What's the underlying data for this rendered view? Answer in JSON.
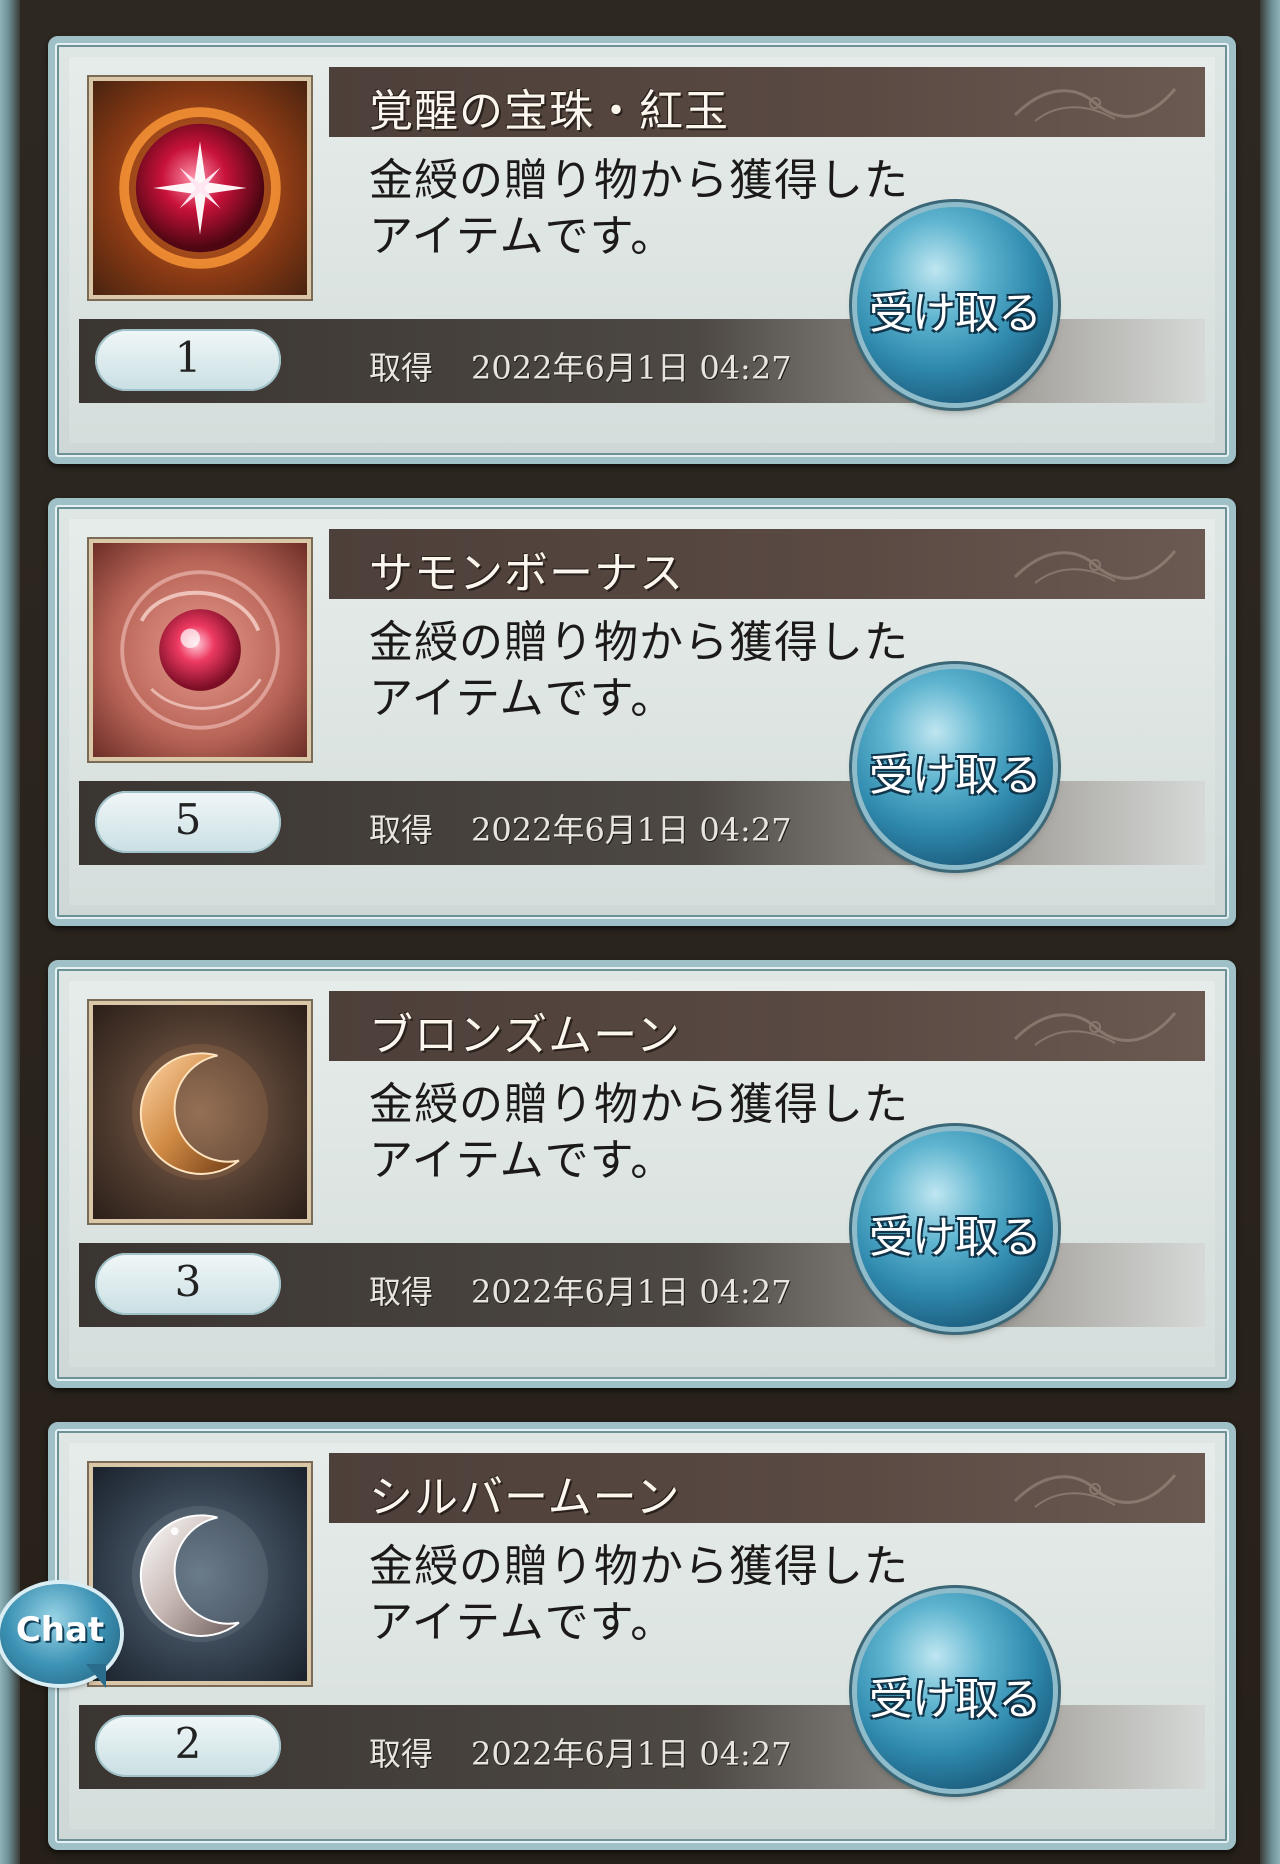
{
  "present_list": {
    "items": [
      {
        "name": "覚醒の宝珠・紅玉",
        "description": "金綬の贈り物から獲得したアイテムです。",
        "quantity": "1",
        "acquired_label": "取得",
        "acquired_date": "2022年6月1日 04:27",
        "receive_label": "受け取る",
        "icon": "crimson-orb-icon"
      },
      {
        "name": "サモンボーナス",
        "description": "金綬の贈り物から獲得したアイテムです。",
        "quantity": "5",
        "acquired_label": "取得",
        "acquired_date": "2022年6月1日 04:27",
        "receive_label": "受け取る",
        "icon": "summon-orb-icon"
      },
      {
        "name": "ブロンズムーン",
        "description": "金綬の贈り物から獲得したアイテムです。",
        "quantity": "3",
        "acquired_label": "取得",
        "acquired_date": "2022年6月1日 04:27",
        "receive_label": "受け取る",
        "icon": "bronze-moon-icon"
      },
      {
        "name": "シルバームーン",
        "description": "金綬の贈り物から獲得したアイテムです。",
        "quantity": "2",
        "acquired_label": "取得",
        "acquired_date": "2022年6月1日 04:27",
        "receive_label": "受け取る",
        "icon": "silver-moon-icon"
      }
    ]
  },
  "chat": {
    "label": "Chat"
  },
  "colors": {
    "title_bar": "#4d3f39",
    "button_blue": "#2f8aae",
    "frame_teal": "#9fc0c6",
    "background": "#2b2520"
  }
}
